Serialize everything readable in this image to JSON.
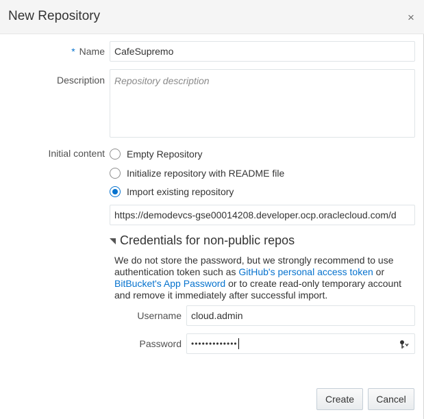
{
  "dialog": {
    "title": "New Repository",
    "close_symbol": "×"
  },
  "form": {
    "required_marker": "*",
    "name_label": "Name",
    "name_value": "CafeSupremo",
    "description_label": "Description",
    "description_placeholder": "Repository description",
    "initial_content_label": "Initial content",
    "options": [
      {
        "label": "Empty Repository",
        "checked": false
      },
      {
        "label": "Initialize repository with README file",
        "checked": false
      },
      {
        "label": "Import existing repository",
        "checked": true
      }
    ],
    "import_url": "https://demodevcs-gse00014208.developer.ocp.oraclecloud.com/d"
  },
  "credentials": {
    "heading": "Credentials for non-public repos",
    "note_part1": "We do not store the password, but we strongly recommend to use authentication token such as ",
    "link1": "GitHub's personal access token",
    "note_part2": " or ",
    "link2": "BitBucket's App Password",
    "note_part3": " or to create read-only temporary account and remove it immediately after successful import.",
    "username_label": "Username",
    "username_value": "cloud.admin",
    "password_label": "Password",
    "password_mask": "•••••••••••••"
  },
  "buttons": {
    "create": "Create",
    "cancel": "Cancel"
  },
  "icons": {
    "close": "close-icon",
    "expand": "triangle-down-icon",
    "key": "key-icon",
    "radio": "radio-icon"
  },
  "colors": {
    "accent": "#0572ce",
    "header_bg": "#f5f5f5"
  }
}
